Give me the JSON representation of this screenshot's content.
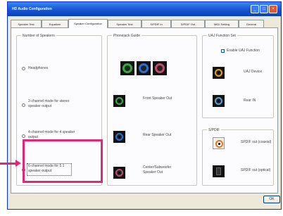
{
  "window": {
    "title": "HD Audio Configuration",
    "buttons": {
      "minimize": "_",
      "maximize": "□",
      "close": "×"
    }
  },
  "tabs": [
    {
      "label": "Speaker Test"
    },
    {
      "label": "Equalizer"
    },
    {
      "label": "Speaker Configuration"
    },
    {
      "label": "Speaker Test"
    },
    {
      "label": "S/PDIF In"
    },
    {
      "label": "S/PDIF Out"
    },
    {
      "label": "MIDI Setting"
    },
    {
      "label": "General"
    }
  ],
  "active_tab_index": 2,
  "number_of_speakers": {
    "title": "Number of Speakers",
    "options": [
      {
        "label": "Headphones",
        "selected": false
      },
      {
        "label": "2-channel mode for stereo\nspeaker output",
        "selected": false
      },
      {
        "label": "4-channel mode for 4 speaker\noutput",
        "selected": false
      },
      {
        "label": "6-channel mode for 5.1\nspeaker output",
        "selected": true
      }
    ]
  },
  "phonejack": {
    "title": "Phonejack Guide",
    "top_jacks": [
      {
        "color": "#2fae3c"
      },
      {
        "color": "#2a6fcf"
      },
      {
        "color": "#c24a6a"
      }
    ],
    "rows": [
      {
        "color": "#2fae3c",
        "label": "Front Speaker Out"
      },
      {
        "color": "#2a6fcf",
        "label": "Rear Speaker Out"
      },
      {
        "color": "#c24a6a",
        "label": "Center/Subwoofer\nSpeaker Out"
      }
    ]
  },
  "uaj": {
    "title": "UAJ Function Set",
    "checkbox_label": "Enable UAJ Function",
    "items": [
      {
        "color": "#e0a02a",
        "label": "UAJ Device"
      },
      {
        "color": "#5aa0d8",
        "label": "Rear IN"
      }
    ]
  },
  "spdif": {
    "title": "S/PDIF",
    "items": [
      {
        "color": "#e07820",
        "label": "SPDIF out (coaxial)"
      },
      {
        "color": "#111111",
        "label": "SPDIF out (optical)"
      }
    ]
  },
  "ok_label": "OK"
}
